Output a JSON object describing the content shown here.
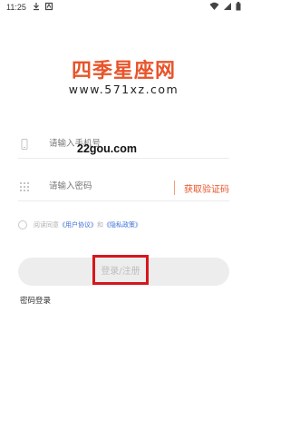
{
  "status_bar": {
    "time": "11:25"
  },
  "logo": {
    "name": "四季星座网",
    "url": "www.571xz.com"
  },
  "watermark": "22gou.com",
  "phone_field": {
    "placeholder": "请输入手机号"
  },
  "password_field": {
    "placeholder": "请输入密码",
    "get_code": "获取验证码"
  },
  "agreement": {
    "prefix": "阅读同意",
    "user_agreement": "《用户协议》",
    "and": "和",
    "privacy_policy": "《隐私政策》"
  },
  "login_button": {
    "label": "登录/注册"
  },
  "password_login": "密码登录",
  "colors": {
    "accent": "#e8542a",
    "link": "#3b6fd6",
    "highlight": "#d8161b"
  }
}
